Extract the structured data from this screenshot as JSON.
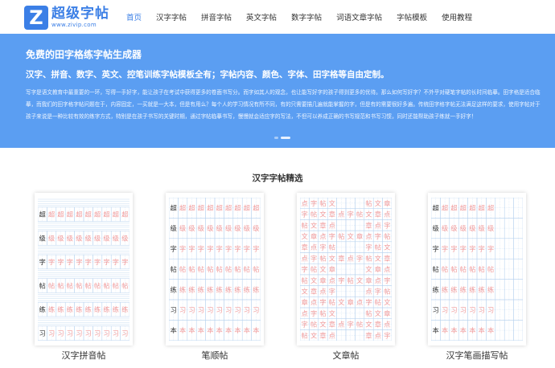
{
  "header": {
    "logo": {
      "letter": "Z",
      "title": "超级字帖",
      "url": "www.zivip.com"
    },
    "nav": [
      "首页",
      "汉字字帖",
      "拼音字帖",
      "英文字帖",
      "数字字帖",
      "词语文章字帖",
      "字帖模板",
      "使用教程"
    ],
    "active_nav": "首页"
  },
  "banner": {
    "title": "免费的田字格练字帖生成器",
    "subtitle": "汉字、拼音、数字、英文、控笔训练字帖模板全有；字帖内容、颜色、字体、田字格等自由定制。",
    "description": "写字是语文教育中最重要的一环，写得一手好字，能让孩子在考试中获得更多的卷面书写分。而字如其人的观念，也让能写好字的孩子得到更多的优待。那么如何写好字？不外乎对硬笔字帖的长时间临摹。田字格是适合临摹，而我们的田字格字帖问题在于，内容固定，一买就是一大本，但是有用么？每个人的学习情况有所不同，有的只需要描几遍就能掌握的字，但是有的需要很好多遍。传统田字格字帖无法满足这样的要求，使用字帖对于孩子来说是一种比较有效的练字方式，特别是在孩子书写的关键时期，通过字帖临摹书写，慢慢就会适应字的写法，不但可以养成正确的书写规范和书写习惯，同时还能帮助孩子练就一手好字！",
    "carousel_active": 1
  },
  "section": {
    "title": "汉字字帖精选"
  },
  "cards": [
    {
      "label": "汉字拼音帖",
      "chars": [
        "超",
        "级",
        "字",
        "帖",
        "练",
        "习"
      ]
    },
    {
      "label": "笔顺帖",
      "chars": [
        "超",
        "级",
        "字",
        "帖",
        "练",
        "习",
        "本"
      ]
    },
    {
      "label": "文章帖",
      "chars": [
        "点",
        "字",
        "帖",
        "文",
        "章"
      ]
    },
    {
      "label": "汉字笔画描写帖",
      "chars": [
        "超",
        "级",
        "字",
        "帖",
        "练",
        "习",
        "本"
      ]
    }
  ],
  "colors": {
    "brand": "#3b7fe6",
    "banner": "#5b9ef2",
    "grid": "#b9d3ef",
    "trace": "#f19a9a"
  }
}
